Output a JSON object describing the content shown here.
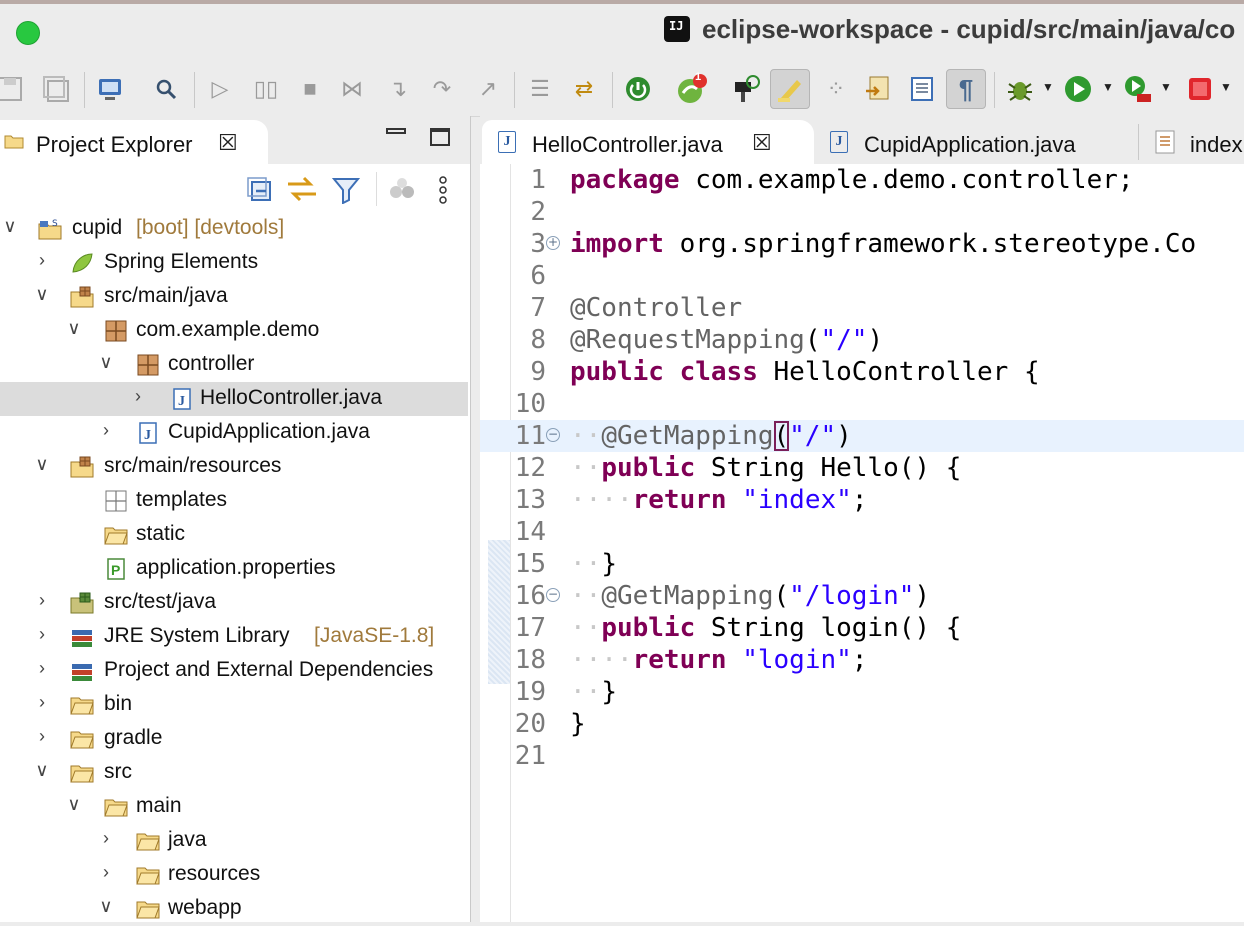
{
  "window": {
    "title": "eclipse-workspace - cupid/src/main/java/co",
    "ide_badge": "IJ",
    "traffic_light_color": "#28c840"
  },
  "toolbar": {
    "icons": [
      "save-icon",
      "save-all-icon",
      "new-window-icon",
      "search-icon",
      "resume-icon",
      "suspend-icon",
      "terminate-icon",
      "disconnect-icon",
      "step-into-icon",
      "step-over-icon",
      "step-return-icon",
      "drop-frame-icon",
      "use-step-filters-icon",
      "spring-boot-icon",
      "spring-update-icon",
      "ant-build-icon",
      "mark-occurrences-icon",
      "spring-beans-icon",
      "open-type-icon",
      "toggle-breadcrumb-icon",
      "show-whitespace-icon",
      "debug-icon",
      "run-icon",
      "run-server-icon",
      "stop-icon"
    ],
    "spring_badge": "1",
    "show_whitespace_symbol": "¶"
  },
  "explorer": {
    "tab_label": "Project Explorer",
    "tree": [
      {
        "label": "cupid",
        "decoration": "[boot] [devtools]",
        "icon": "project-icon",
        "depth": 0,
        "expanded": true
      },
      {
        "label": "Spring Elements",
        "icon": "spring-leaf-icon",
        "depth": 1,
        "expanded": false
      },
      {
        "label": "src/main/java",
        "icon": "source-folder-icon",
        "depth": 1,
        "expanded": true
      },
      {
        "label": "com.example.demo",
        "icon": "package-icon",
        "depth": 2,
        "expanded": true
      },
      {
        "label": "controller",
        "icon": "package-icon",
        "depth": 3,
        "expanded": true
      },
      {
        "label": "HelloController.java",
        "icon": "java-file-icon",
        "depth": 4,
        "expanded": false,
        "selected": true
      },
      {
        "label": "CupidApplication.java",
        "icon": "java-file-icon",
        "depth": 3,
        "expanded": false
      },
      {
        "label": "src/main/resources",
        "icon": "source-folder-icon",
        "depth": 1,
        "expanded": true
      },
      {
        "label": "templates",
        "icon": "empty-package-icon",
        "depth": 2,
        "leaf": true
      },
      {
        "label": "static",
        "icon": "folder-icon",
        "depth": 2,
        "leaf": true
      },
      {
        "label": "application.properties",
        "icon": "properties-file-icon",
        "depth": 2,
        "leaf": true
      },
      {
        "label": "src/test/java",
        "icon": "source-folder-icon",
        "depth": 1,
        "expanded": false
      },
      {
        "label": "JRE System Library",
        "decoration": "[JavaSE-1.8]",
        "icon": "library-icon",
        "depth": 1,
        "expanded": false
      },
      {
        "label": "Project and External Dependencies",
        "icon": "library-icon",
        "depth": 1,
        "expanded": false
      },
      {
        "label": "bin",
        "icon": "folder-icon",
        "depth": 1,
        "expanded": false
      },
      {
        "label": "gradle",
        "icon": "folder-icon",
        "depth": 1,
        "expanded": false
      },
      {
        "label": "src",
        "icon": "folder-icon",
        "depth": 1,
        "expanded": true
      },
      {
        "label": "main",
        "icon": "folder-icon",
        "depth": 2,
        "expanded": true
      },
      {
        "label": "java",
        "icon": "folder-icon",
        "depth": 3,
        "expanded": false
      },
      {
        "label": "resources",
        "icon": "folder-icon",
        "depth": 3,
        "expanded": false
      },
      {
        "label": "webapp",
        "icon": "folder-icon",
        "depth": 3,
        "expanded": true
      }
    ]
  },
  "editor": {
    "tabs": [
      {
        "label": "HelloController.java",
        "active": true,
        "closable": true
      },
      {
        "label": "CupidApplication.java",
        "active": false
      },
      {
        "label": "index",
        "active": false
      }
    ],
    "current_line": 11,
    "lines": [
      {
        "n": "1",
        "tokens": [
          {
            "t": "package",
            "c": "kw"
          },
          {
            "t": " ",
            "c": "ws"
          },
          {
            "t": "com.example.demo.controller;",
            "c": ""
          }
        ]
      },
      {
        "n": "2",
        "tokens": []
      },
      {
        "n": "3",
        "fold": "+",
        "tokens": [
          {
            "t": "import",
            "c": "kw"
          },
          {
            "t": " ",
            "c": "ws"
          },
          {
            "t": "org.springframework.stereotype.Co",
            "c": ""
          }
        ]
      },
      {
        "n": "6",
        "tokens": []
      },
      {
        "n": "7",
        "tokens": [
          {
            "t": "@Controller",
            "c": "ann"
          }
        ]
      },
      {
        "n": "8",
        "tokens": [
          {
            "t": "@RequestMapping",
            "c": "ann"
          },
          {
            "t": "(",
            "c": ""
          },
          {
            "t": "\"/\"",
            "c": "str"
          },
          {
            "t": ")",
            "c": ""
          }
        ]
      },
      {
        "n": "9",
        "tokens": [
          {
            "t": "public",
            "c": "kw"
          },
          {
            "t": " ",
            "c": "ws"
          },
          {
            "t": "class",
            "c": "kw"
          },
          {
            "t": " HelloController {",
            "c": ""
          }
        ]
      },
      {
        "n": "10",
        "tokens": []
      },
      {
        "n": "11",
        "fold": "−",
        "tokens": [
          {
            "t": "··",
            "c": "ws"
          },
          {
            "t": "@GetMapping",
            "c": "ann"
          },
          {
            "t": "(",
            "c": "bracket"
          },
          {
            "t": "\"/\"",
            "c": "str"
          },
          {
            "t": ")",
            "c": ""
          }
        ]
      },
      {
        "n": "12",
        "tokens": [
          {
            "t": "··",
            "c": "ws"
          },
          {
            "t": "public",
            "c": "kw"
          },
          {
            "t": " String Hello() {",
            "c": ""
          }
        ]
      },
      {
        "n": "13",
        "tokens": [
          {
            "t": "····",
            "c": "ws"
          },
          {
            "t": "return",
            "c": "kw"
          },
          {
            "t": " ",
            "c": "ws"
          },
          {
            "t": "\"index\"",
            "c": "str"
          },
          {
            "t": ";",
            "c": ""
          }
        ]
      },
      {
        "n": "14",
        "tokens": []
      },
      {
        "n": "15",
        "tokens": [
          {
            "t": "··",
            "c": "ws"
          },
          {
            "t": "}",
            "c": ""
          }
        ]
      },
      {
        "n": "16",
        "fold": "−",
        "tokens": [
          {
            "t": "··",
            "c": "ws"
          },
          {
            "t": "@GetMapping",
            "c": "ann"
          },
          {
            "t": "(",
            "c": ""
          },
          {
            "t": "\"/login\"",
            "c": "str"
          },
          {
            "t": ")",
            "c": ""
          }
        ]
      },
      {
        "n": "17",
        "tokens": [
          {
            "t": "··",
            "c": "ws"
          },
          {
            "t": "public",
            "c": "kw"
          },
          {
            "t": " String login() {",
            "c": ""
          }
        ]
      },
      {
        "n": "18",
        "tokens": [
          {
            "t": "····",
            "c": "ws"
          },
          {
            "t": "return",
            "c": "kw"
          },
          {
            "t": " ",
            "c": "ws"
          },
          {
            "t": "\"login\"",
            "c": "str"
          },
          {
            "t": ";",
            "c": ""
          }
        ]
      },
      {
        "n": "19",
        "tokens": [
          {
            "t": "··",
            "c": "ws"
          },
          {
            "t": "}",
            "c": ""
          }
        ]
      },
      {
        "n": "20",
        "tokens": [
          {
            "t": "}",
            "c": ""
          }
        ]
      },
      {
        "n": "21",
        "tokens": []
      }
    ]
  },
  "colors": {
    "keyword": "#7f0055",
    "annotation": "#646464",
    "string": "#2a00ff",
    "selection": "#dcdcdc",
    "current_line": "#e8f2fe"
  }
}
